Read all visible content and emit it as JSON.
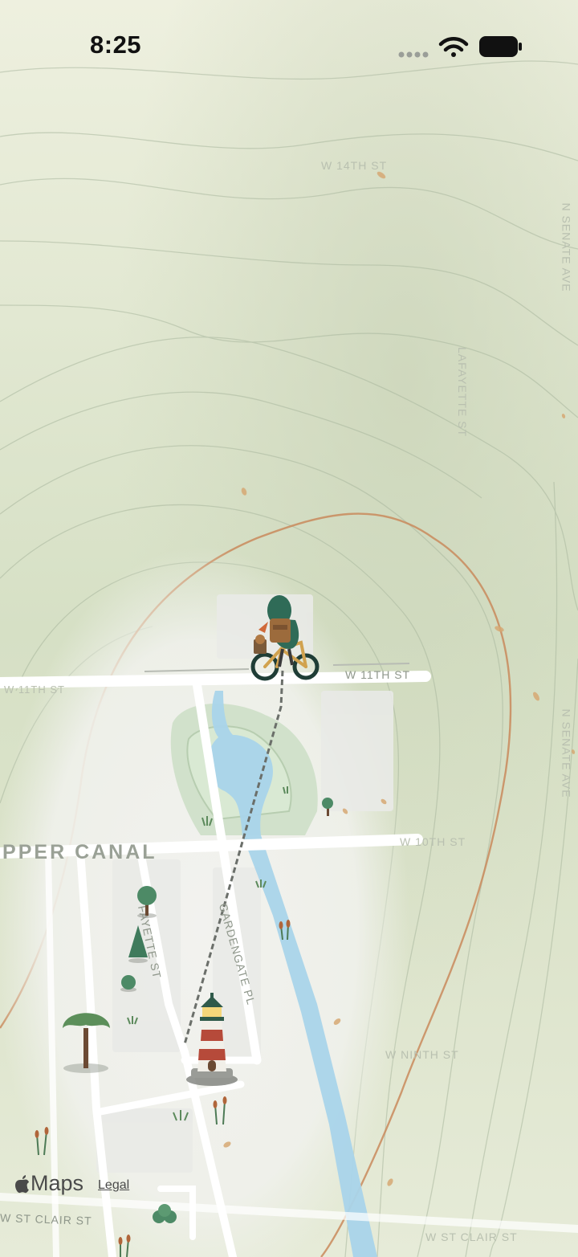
{
  "status_bar": {
    "time": "8:25"
  },
  "map": {
    "colors": {
      "water": "#a9d4ea",
      "contour_accent": "#c98a5c",
      "road": "#ffffff",
      "park": "#c7dcc0"
    },
    "streets": {
      "w_14th": "W 14TH ST",
      "w_11th_main": "W 11TH ST",
      "w_11th_left": "W 11TH ST",
      "w_10th": "W 10TH ST",
      "w_ninth": "W NINTH ST",
      "lafayette_upper": "LAFAYETTE ST",
      "fayette": "FAYETTE ST",
      "gardengate": "GARDENGATE PL",
      "w_st_clair_left": "W ST CLAIR ST",
      "w_st_clair_right": "W ST CLAIR ST",
      "nsenate_upper": "N SENATE AVE",
      "nsenate_lower": "N SENATE AVE"
    },
    "district_label": "UPPER CANAL",
    "markers": {
      "player": "cyclist-avatar-icon",
      "destination": "lighthouse-icon"
    }
  },
  "attribution": {
    "brand": "Maps",
    "legal": "Legal"
  }
}
